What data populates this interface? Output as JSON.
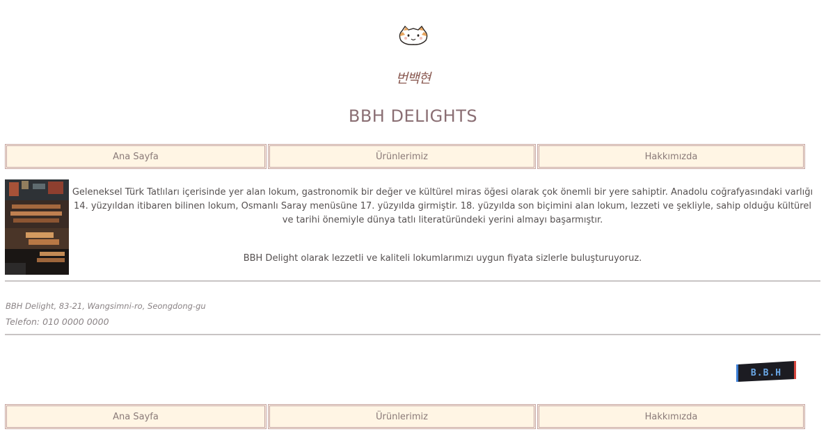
{
  "header": {
    "logo_icon": "cat-face-icon",
    "korean_logo_text": "번백현",
    "site_title": "BBH DELIGHTS"
  },
  "nav": {
    "items": [
      {
        "label": "Ana Sayfa"
      },
      {
        "label": "Ürünlerimiz"
      },
      {
        "label": "Hakkımızda"
      }
    ]
  },
  "main": {
    "intro_text": "Geleneksel Türk Tatlıları içerisinde yer alan lokum, gastronomik bir değer ve kültürel miras öğesi olarak çok önemli bir yere sahiptir. Anadolu coğrafyasındaki varlığı 14. yüzyıldan itibaren bilinen lokum, Osmanlı Saray menüsüne 17. yüzyılda girmiştir. 18. yüzyılda son biçimini alan lokum, lezzeti ve şekliyle, sahip olduğu kültürel ve tarihi önemiyle dünya tatlı literatüründeki yerini almayı başarmıştır.",
    "promo_text": "BBH Delight olarak lezzetli ve kaliteli lokumlarımızı uygun fiyata sizlerle buluşturuyoruz."
  },
  "footer": {
    "address": "BBH Delight, 83-21, Wangsimni-ro, Seongdong-gu",
    "phone": "Telefon: 010 0000 0000",
    "badge_text": "B.B.H"
  },
  "colors": {
    "nav_background": "#fff5e4",
    "nav_border": "#c4a4a4",
    "title": "#8a6e73",
    "body_text": "#555050"
  }
}
